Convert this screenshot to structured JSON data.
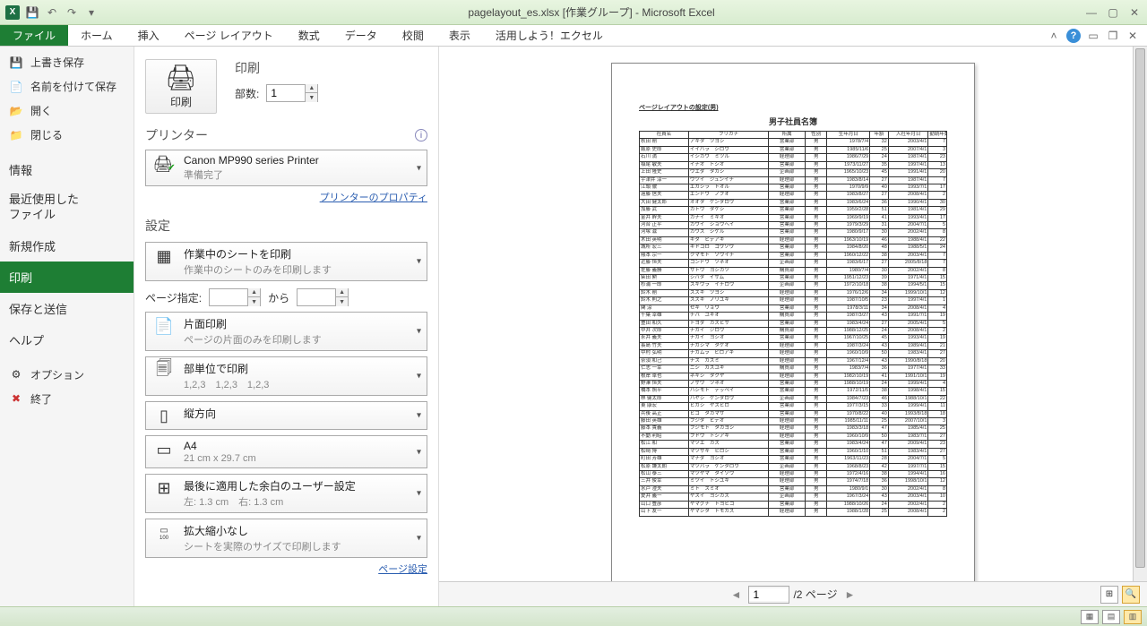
{
  "window": {
    "title": "pagelayout_es.xlsx [作業グループ] - Microsoft Excel"
  },
  "ribbon": {
    "file": "ファイル",
    "home": "ホーム",
    "insert": "挿入",
    "pagelayout": "ページ レイアウト",
    "formulas": "数式",
    "data": "データ",
    "review": "校閲",
    "view": "表示",
    "addin": "活用しよう！エクセル"
  },
  "nav": {
    "save": "上書き保存",
    "saveas": "名前を付けて保存",
    "open": "開く",
    "close": "閉じる",
    "info": "情報",
    "recent1": "最近使用した",
    "recent2": "ファイル",
    "new": "新規作成",
    "print": "印刷",
    "share": "保存と送信",
    "help": "ヘルプ",
    "options": "オプション",
    "exit": "終了"
  },
  "print": {
    "heading": "印刷",
    "button": "印刷",
    "copies_label": "部数:",
    "copies_value": "1"
  },
  "printer": {
    "heading": "プリンター",
    "name": "Canon MP990 series Printer",
    "status": "準備完了",
    "properties_link": "プリンターのプロパティ"
  },
  "settings": {
    "heading": "設定",
    "active_sheets_title": "作業中のシートを印刷",
    "active_sheets_sub": "作業中のシートのみを印刷します",
    "page_range_label": "ページ指定:",
    "page_range_to": "から",
    "one_sided_title": "片面印刷",
    "one_sided_sub": "ページの片面のみを印刷します",
    "collated_title": "部単位で印刷",
    "collated_sub": "1,2,3　1,2,3　1,2,3",
    "orientation": "縦方向",
    "paper_title": "A4",
    "paper_sub": "21 cm x 29.7 cm",
    "margins_title": "最後に適用した余白のユーザー設定",
    "margins_sub": "左: 1.3 cm　右: 1.3 cm",
    "scaling_title": "拡大縮小なし",
    "scaling_sub": "シートを実際のサイズで印刷します",
    "page_setup_link": "ページ設定"
  },
  "pager": {
    "current": "1",
    "total_label": "/2 ページ"
  },
  "preview": {
    "header_text": "ページレイアウトの設定(男)",
    "title": "男子社員名簿",
    "columns": [
      "社員名",
      "フリガナ",
      "所属",
      "性別",
      "生年月日",
      "年齢",
      "入社年月日",
      "勤続年数"
    ],
    "rows": [
      [
        "秋田 剛",
        "アキタ　ツヨシ",
        "営業部",
        "男",
        "1978/7/4",
        "32",
        "2003/4/1",
        "7"
      ],
      [
        "飯原 史郎",
        "イイハラ　シロウ",
        "営業部",
        "男",
        "1985/11/6",
        "25",
        "2007/4/1",
        "3"
      ],
      [
        "石川 満",
        "イシカワ　ミツル",
        "経理部",
        "男",
        "1986/7/29",
        "24",
        "1987/4/1",
        "23"
      ],
      [
        "稲尾 敏夫",
        "イナオ　トシオ",
        "営業部",
        "男",
        "1973/11/27",
        "35",
        "1997/4/1",
        "13"
      ],
      [
        "上田 隆史",
        "ウエダ　タカシ",
        "企画部",
        "男",
        "1965/10/23",
        "45",
        "1991/4/1",
        "20"
      ],
      [
        "宇津井 淳一",
        "ウツイ　ジュンイチ",
        "経理部",
        "男",
        "1983/8/14",
        "27",
        "1987/4/1",
        "7"
      ],
      [
        "江頭 徹",
        "エガシラ　トオル",
        "営業部",
        "男",
        "1970/9/9",
        "40",
        "1993/7/1",
        "17"
      ],
      [
        "遠藤 信夫",
        "エンドウ　ノブオ",
        "経理部",
        "男",
        "1983/8/27",
        "27",
        "2008/4/1",
        "2"
      ],
      [
        "大田 健太郎",
        "オオタ　ケンタロウ",
        "営業部",
        "男",
        "1983/6/24",
        "36",
        "1990/4/1",
        "30"
      ],
      [
        "加藤 武",
        "カトウ　タケシ",
        "営業部",
        "男",
        "1959/2/28",
        "51",
        "1981/4/1",
        "29"
      ],
      [
        "金井 幹夫",
        "カナイ　ミキオ",
        "営業部",
        "男",
        "1969/9/19",
        "41",
        "1993/4/1",
        "17"
      ],
      [
        "河合 正平",
        "カワイ　ショウヘイ",
        "営業部",
        "男",
        "1979/3/29",
        "31",
        "2004/7/1",
        "5"
      ],
      [
        "河塚 滋",
        "カワズ　シゲル",
        "営業部",
        "男",
        "1980/9/17",
        "30",
        "2002/4/1",
        "8"
      ],
      [
        "木田 英明",
        "キダ　ヒデアキ",
        "経理部",
        "男",
        "1963/10/19",
        "46",
        "1988/4/1",
        "22"
      ],
      [
        "城所 宏三",
        "キドコロ　コウゾウ",
        "営業部",
        "男",
        "1984/8/20",
        "48",
        "1988/5/1",
        "24"
      ],
      [
        "隈本 宗一",
        "クマモト　ソウイチ",
        "営業部",
        "男",
        "1960/12/22",
        "38",
        "2003/4/1",
        "7"
      ],
      [
        "近藤 恒夫",
        "コンドウ　ツネオ",
        "企画部",
        "男",
        "1983/6/17",
        "27",
        "2005/8/18",
        "7"
      ],
      [
        "佐藤 義勝",
        "サトウ　ヨシカツ",
        "購買部",
        "男",
        "1980/7/4",
        "30",
        "2002/4/1",
        "8"
      ],
      [
        "柴田 勲",
        "シバタ　イサム",
        "営業部",
        "男",
        "1951/12/23",
        "39",
        "1971/4/1",
        "15"
      ],
      [
        "杉浦 一郎",
        "スギウラ　イチロウ",
        "企画部",
        "男",
        "1972/10/18",
        "38",
        "1994/5/1",
        "15"
      ],
      [
        "鈴木 剛",
        "スズキ　ツヨシ",
        "経理部",
        "男",
        "1976/12/6",
        "34",
        "1999/10/1",
        "12"
      ],
      [
        "鈴木 則之",
        "スズキ　ノリユキ",
        "経理部",
        "男",
        "1987/10/5",
        "23",
        "1997/4/1",
        "1"
      ],
      [
        "関 涼",
        "セキ　リョウ",
        "営業部",
        "男",
        "1978/3/11",
        "34",
        "2008/4/1",
        "4"
      ],
      [
        "千葉 幸雄",
        "チバ　ユキオ",
        "購買部",
        "男",
        "1987/3/27",
        "43",
        "1991/7/1",
        "19"
      ],
      [
        "豊田 和久",
        "トヨダ　カズヒサ",
        "営業部",
        "男",
        "1983/4/24",
        "27",
        "2005/4/1",
        "5"
      ],
      [
        "中井 次郎",
        "ナカイ　ジロウ",
        "購買部",
        "男",
        "1988/12/25",
        "24",
        "2008/4/1",
        "2"
      ],
      [
        "永井 義夫",
        "ナガイ　ヨシオ",
        "営業部",
        "男",
        "1967/10/25",
        "45",
        "1993/4/1",
        "19"
      ],
      [
        "長島 竹夫",
        "ナガシマ　タケオ",
        "経理部",
        "男",
        "1987/3/24",
        "43",
        "1989/4/1",
        "21"
      ],
      [
        "中村 弘明",
        "ナカムラ　ヒロアキ",
        "経理部",
        "男",
        "1960/10/9",
        "50",
        "1983/4/1",
        "27"
      ],
      [
        "奈須 和己",
        "ナス　カズミ",
        "経理部",
        "男",
        "1967/12/4",
        "43",
        "1990/8/18",
        "20"
      ],
      [
        "仁志 一幸",
        "ニシ　カズユキ",
        "購買部",
        "男",
        "1983/7/4",
        "36",
        "1977/4/1",
        "33"
      ],
      [
        "根岸 卓也",
        "ネギシ　タクヤ",
        "経理部",
        "男",
        "1982/10/19",
        "41",
        "1991/10/1",
        "19"
      ],
      [
        "野澤 恒夫",
        "ノザワ　ツネオ",
        "営業部",
        "男",
        "1988/10/19",
        "24",
        "1999/4/1",
        "4"
      ],
      [
        "橋本 照平",
        "ハシモト　テッペイ",
        "営業部",
        "男",
        "1972/11/5",
        "38",
        "1998/4/1",
        "15"
      ],
      [
        "林 健太郎",
        "ハヤシ　ケンタロウ",
        "企画部",
        "男",
        "1984/7/23",
        "46",
        "1988/10/1",
        "22"
      ],
      [
        "東 康宏",
        "ヒガシ　ヤスヒロ",
        "営業部",
        "男",
        "1977/3/15",
        "33",
        "1999/4/1",
        "11"
      ],
      [
        "兵後 高正",
        "ヒゴ　タカマサ",
        "営業部",
        "男",
        "1970/8/22",
        "40",
        "1993/8/18",
        "18"
      ],
      [
        "藤田 英雄",
        "フジタ　ヒデオ",
        "経理部",
        "男",
        "1985/11/11",
        "25",
        "2007/10/1",
        "3"
      ],
      [
        "藤本 貴義",
        "フジモト　タカヨシ",
        "経理部",
        "男",
        "1983/3/18",
        "47",
        "1985/4/1",
        "25"
      ],
      [
        "不動 利昭",
        "フドウ　トシアキ",
        "経理部",
        "男",
        "1960/10/9",
        "50",
        "1983/7/1",
        "27"
      ],
      [
        "松江 和",
        "マツエ　カズ",
        "営業部",
        "男",
        "1983/4/24",
        "47",
        "2009/4/1",
        "23"
      ],
      [
        "松崎 博",
        "マツザキ　ヒロシ",
        "営業部",
        "男",
        "1960/1/10",
        "51",
        "1983/4/1",
        "27"
      ],
      [
        "町田 芳雄",
        "マチダ　ヨシオ",
        "営業部",
        "男",
        "1963/11/23",
        "28",
        "2004/7/1",
        "5"
      ],
      [
        "松原 謙太朗",
        "マツバラ　ケンタロウ",
        "企画部",
        "男",
        "1968/8/23",
        "42",
        "1997/7/1",
        "15"
      ],
      [
        "松山 泰三",
        "マツヤマ　タイゾウ",
        "経理部",
        "男",
        "1972/4/16",
        "38",
        "1994/4/1",
        "16"
      ],
      [
        "三井 俊幸",
        "ミツイ　トシユキ",
        "経理部",
        "男",
        "1974/7/18",
        "36",
        "1998/10/1",
        "12"
      ],
      [
        "水戸 澄夫",
        "ミト　スミオ",
        "営業部",
        "男",
        "1980/9/1",
        "30",
        "2002/4/1",
        "8"
      ],
      [
        "愛井 義一",
        "ヤスイ　ヨシカズ",
        "企画部",
        "男",
        "1967/3/24",
        "43",
        "2003/4/1",
        "10"
      ],
      [
        "山口 豊彦",
        "ヤマグチ　トヨヒコ",
        "営業部",
        "男",
        "1988/10/26",
        "24",
        "2002/4/1",
        "2"
      ],
      [
        "山下 友一",
        "ヤマシタ　トモカズ",
        "経理部",
        "男",
        "1988/1/28",
        "25",
        "2008/4/1",
        "2"
      ]
    ]
  }
}
